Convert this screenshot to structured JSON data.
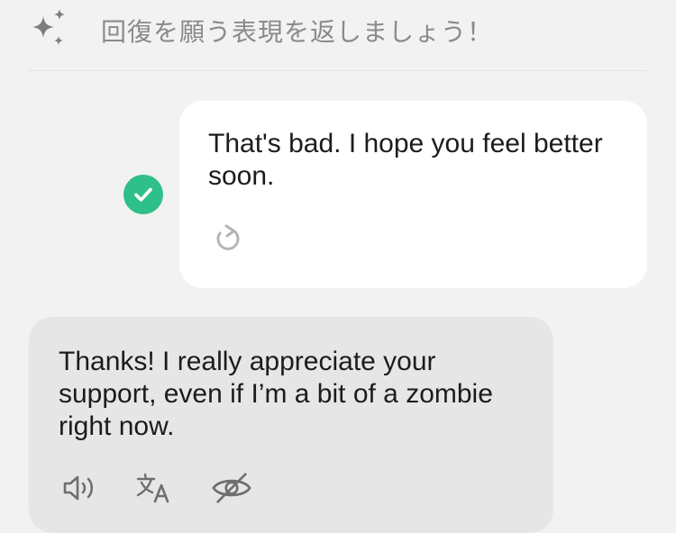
{
  "header": {
    "title": "回復を願う表現を返しましょう！",
    "icon": "sparkle-icon"
  },
  "user_message": {
    "text": "That's bad. I hope you feel better soon.",
    "status_icon": "check-circle-icon",
    "action_icon": "retry-icon"
  },
  "bot_message": {
    "text": "Thanks! I really appreciate your support, even if I’m a bit of a zombie right now.",
    "actions": [
      {
        "name": "speaker-icon"
      },
      {
        "name": "translate-icon"
      },
      {
        "name": "hide-eye-icon"
      }
    ]
  },
  "colors": {
    "background": "#f2f2f2",
    "user_bubble": "#ffffff",
    "bot_bubble": "#e6e6e6",
    "accent_green": "#2fc08a",
    "icon_gray": "#8a8a8a",
    "text": "#1c1c1c"
  }
}
